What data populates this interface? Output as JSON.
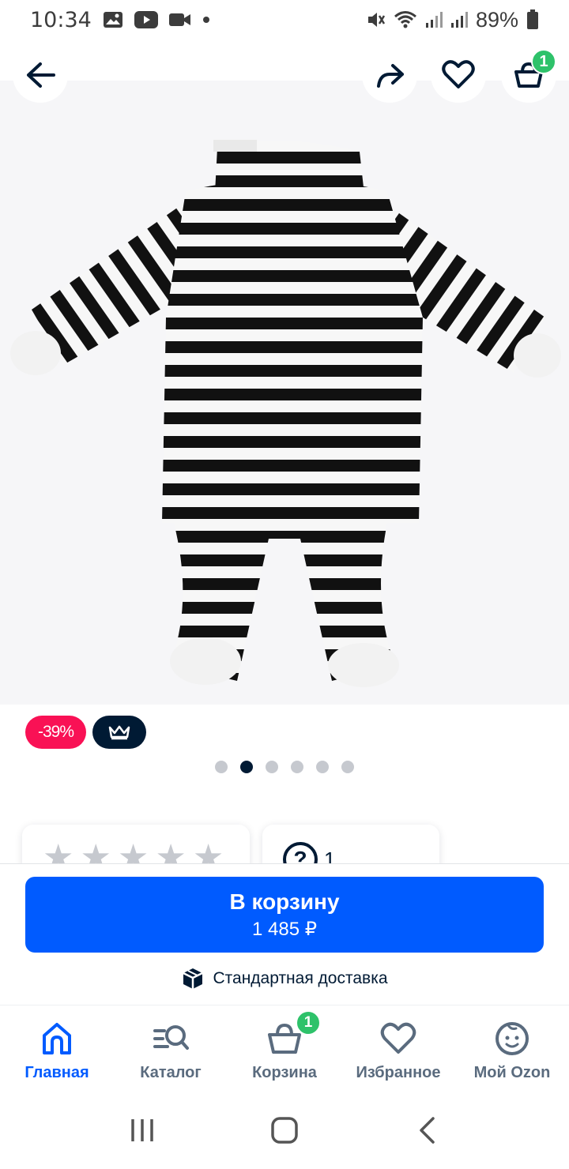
{
  "status_bar": {
    "time": "10:34",
    "battery": "89%"
  },
  "product": {
    "discount": "-39%",
    "image_count": 6,
    "active_image": 2
  },
  "info": {
    "questions_count": "1"
  },
  "buy": {
    "button_label": "В корзину",
    "price": "1 485 ₽",
    "delivery": "Стандартная доставка"
  },
  "header": {
    "cart_count": "1"
  },
  "bottom_nav": {
    "items": [
      {
        "label": "Главная"
      },
      {
        "label": "Каталог"
      },
      {
        "label": "Корзина",
        "badge": "1"
      },
      {
        "label": "Избранное"
      },
      {
        "label": "Мой Ozon"
      }
    ]
  },
  "colors": {
    "accent": "#005bff",
    "discount": "#f91155",
    "badge_green": "#2ec26a",
    "dark": "#001a34"
  }
}
